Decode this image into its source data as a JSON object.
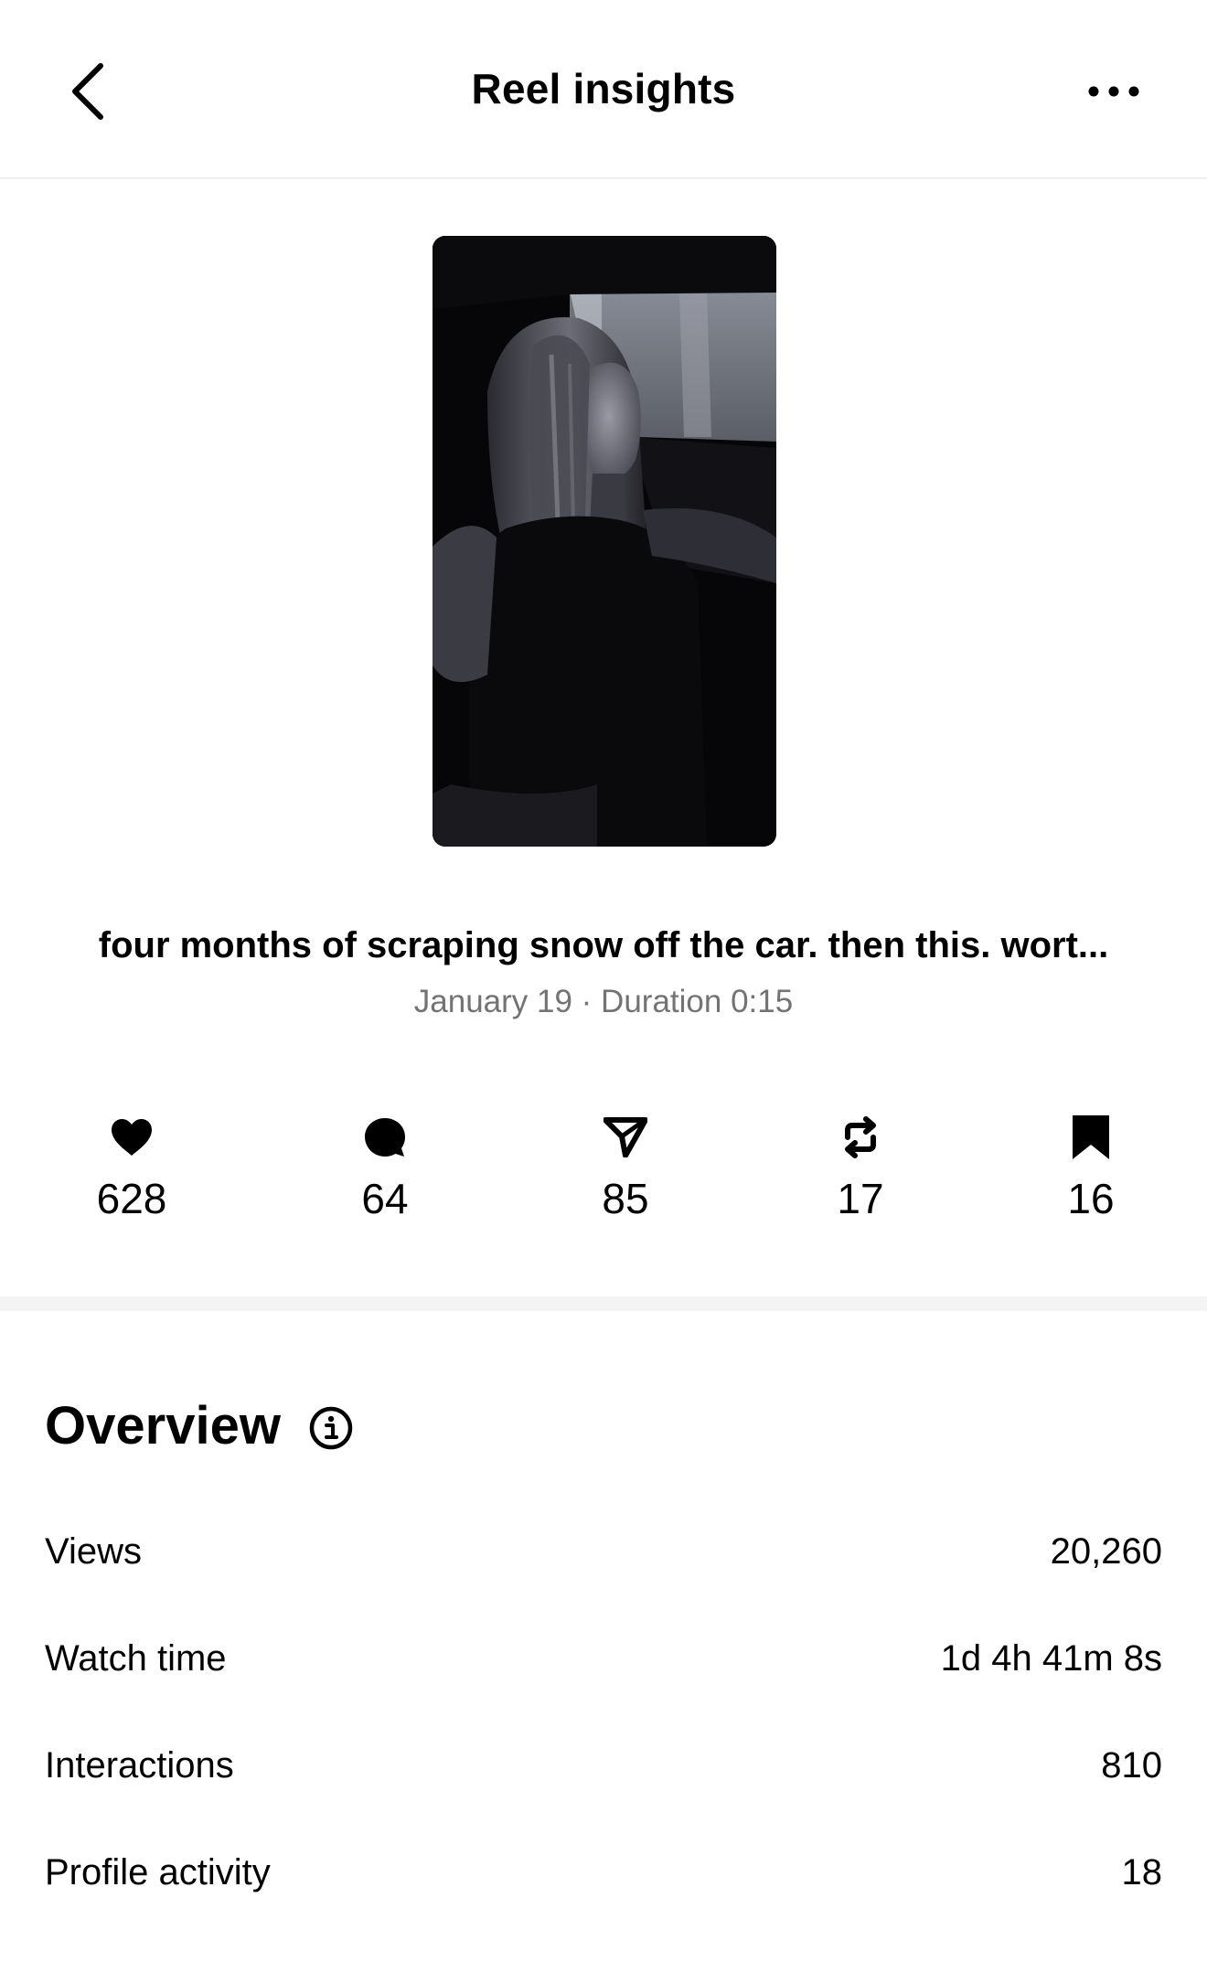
{
  "header": {
    "title": "Reel insights"
  },
  "reel": {
    "caption": "four months of scraping snow off the car. then this. wort...",
    "meta": "January 19 · Duration 0:15"
  },
  "stats": {
    "likes": "628",
    "comments": "64",
    "shares": "85",
    "reposts": "17",
    "saves": "16"
  },
  "overview": {
    "title": "Overview",
    "rows": [
      {
        "label": "Views",
        "value": "20,260"
      },
      {
        "label": "Watch time",
        "value": "1d 4h 41m 8s"
      },
      {
        "label": "Interactions",
        "value": "810"
      },
      {
        "label": "Profile activity",
        "value": "18"
      }
    ]
  },
  "icons": {
    "back": "chevron-left-icon",
    "more": "more-horizontal-icon",
    "likes": "heart-icon",
    "comments": "comment-bubble-icon",
    "shares": "send-icon",
    "reposts": "repost-icon",
    "saves": "bookmark-icon",
    "info": "info-icon"
  },
  "colors": {
    "text": "#000000",
    "muted": "#737373",
    "band": "#f4f4f5"
  }
}
